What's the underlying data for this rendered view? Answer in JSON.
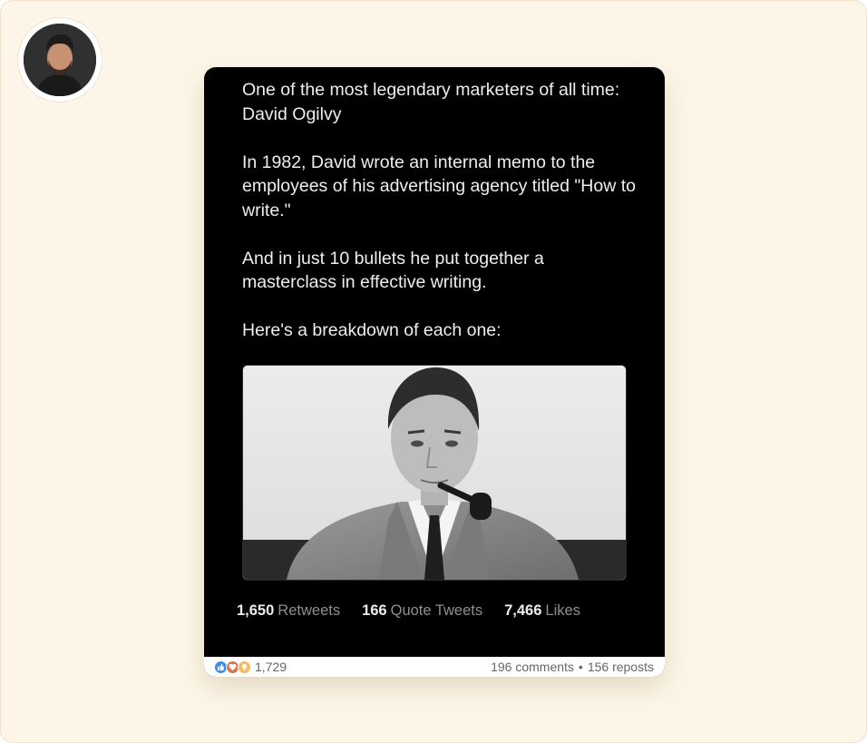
{
  "tweet": {
    "paragraphs": [
      "One of the most legendary marketers of all time: David Ogilvy",
      "In 1982, David wrote an internal memo to the employees of his advertising agency titled \"How to write.\"",
      "And in just 10 bullets he put together a masterclass in effective writing.",
      "Here's a breakdown of each one:"
    ],
    "stats": [
      {
        "value": "1,650",
        "label": "Retweets"
      },
      {
        "value": "166",
        "label": "Quote Tweets"
      },
      {
        "value": "7,466",
        "label": "Likes"
      }
    ]
  },
  "engagement": {
    "reaction_icons": [
      "like-icon",
      "love-icon",
      "insightful-icon"
    ],
    "reaction_count": "1,729",
    "comments": "196 comments",
    "separator": "•",
    "reposts": "156 reposts"
  },
  "colors": {
    "page_background": "#fdf6e8",
    "card_background": "#000000",
    "like_blue": "#378fe9",
    "love_red": "#df704d",
    "insight_yellow": "#f5bb5c"
  }
}
